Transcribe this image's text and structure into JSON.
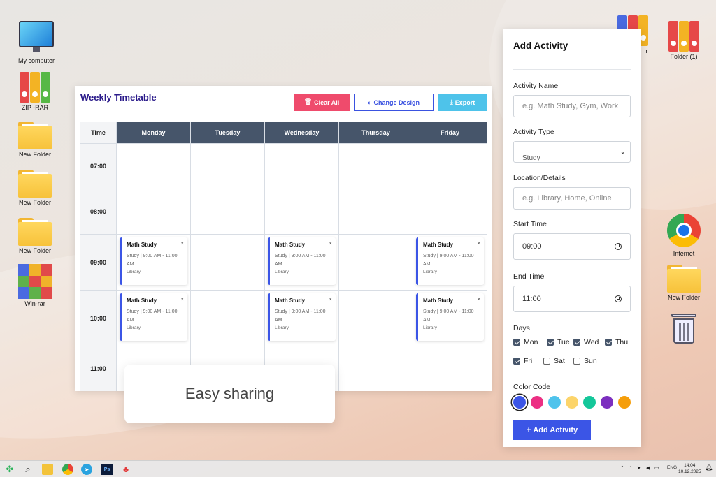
{
  "desktop": {
    "left_icons": [
      {
        "label": "My computer"
      },
      {
        "label": "ZIP -RAR"
      },
      {
        "label": "New Folder"
      },
      {
        "label": "New Folder"
      },
      {
        "label": "New Folder"
      },
      {
        "label": "Win-rar"
      }
    ],
    "right_icons": [
      {
        "label": "Folder (1)"
      },
      {
        "label": "Internet"
      },
      {
        "label": "New Folder"
      }
    ],
    "partial_label": "r"
  },
  "timetable": {
    "title": "Weekly Timetable",
    "buttons": {
      "clear": "Clear All",
      "design": "Change Design",
      "export": "Export"
    },
    "time_header": "Time",
    "days": [
      "Monday",
      "Tuesday",
      "Wednesday",
      "Thursday",
      "Friday"
    ],
    "rows": [
      {
        "time": "07:00"
      },
      {
        "time": "08:00"
      },
      {
        "time": "09:00"
      },
      {
        "time": "10:00"
      },
      {
        "time": "11:00"
      }
    ],
    "card": {
      "title": "Math Study",
      "detail": "Study | 9:00 AM - 11:00 AM",
      "location": "Library",
      "close": "×"
    }
  },
  "overlay": {
    "text": "Easy sharing"
  },
  "form": {
    "title": "Add Activity",
    "name_label": "Activity Name",
    "name_placeholder": "e.g. Math Study, Gym, Work",
    "type_label": "Activity Type",
    "type_value": "Study",
    "location_label": "Location/Details",
    "location_placeholder": "e.g. Library, Home, Online",
    "start_label": "Start Time",
    "start_value": "09:00",
    "end_label": "End Time",
    "end_value": "11:00",
    "days_label": "Days",
    "days": [
      {
        "label": "Mon",
        "checked": true
      },
      {
        "label": "Tue",
        "checked": true
      },
      {
        "label": "Wed",
        "checked": true
      },
      {
        "label": "Thu",
        "checked": true
      },
      {
        "label": "Fri",
        "checked": true
      },
      {
        "label": "Sat",
        "checked": false
      },
      {
        "label": "Sun",
        "checked": false
      }
    ],
    "color_label": "Color Code",
    "colors": [
      "#3b55e6",
      "#ec2f83",
      "#4fc3ec",
      "#fcd46a",
      "#14c79a",
      "#7c2fbf",
      "#f59e0b"
    ],
    "selected_color": "#3b55e6",
    "add_button": "Add Activity"
  },
  "taskbar": {
    "apps": [
      "start-icon",
      "search-icon",
      "file-explorer-icon",
      "chrome-icon",
      "telegram-icon",
      "photoshop-icon",
      "app-icon"
    ],
    "lang": "ENG",
    "time": "14:04",
    "date": "10.12.2025"
  }
}
